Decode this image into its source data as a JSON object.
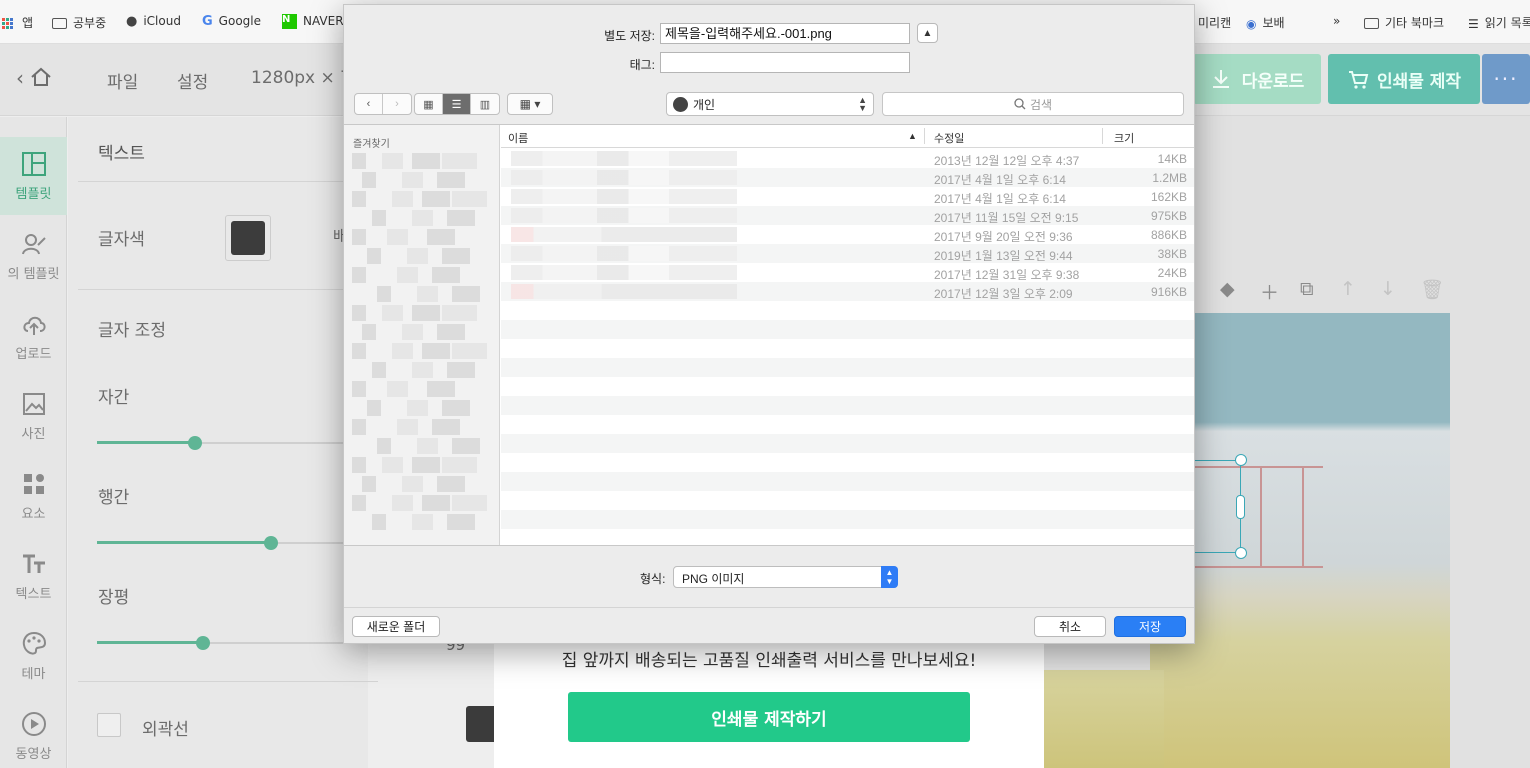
{
  "bookmarks": {
    "items": [
      "앱",
      "공부중",
      "iCloud",
      "Google",
      "NAVER",
      "미리캔",
      "보배",
      "기타 북마크",
      "읽기 목록"
    ],
    "overflow": "»"
  },
  "app_header": {
    "menu_file": "파일",
    "menu_settings": "설정",
    "canvas_size": "1280px × 7",
    "download_label": "다운로드",
    "print_label": "인쇄물 제작",
    "more_label": "···"
  },
  "sidebar": {
    "items": [
      {
        "label": "템플릿",
        "icon": "layout-icon",
        "active": true
      },
      {
        "label": "의 템플릿",
        "icon": "user-edit-icon",
        "active": false
      },
      {
        "label": "업로드",
        "icon": "cloud-upload-icon",
        "active": false
      },
      {
        "label": "사진",
        "icon": "image-icon",
        "active": false
      },
      {
        "label": "요소",
        "icon": "shapes-icon",
        "active": false
      },
      {
        "label": "텍스트",
        "icon": "text-icon",
        "active": false
      },
      {
        "label": "테마",
        "icon": "palette-icon",
        "active": false
      },
      {
        "label": "동영상",
        "icon": "play-icon",
        "active": false
      }
    ]
  },
  "text_panel": {
    "title": "텍스트",
    "font_color_label": "글자색",
    "font_color": "#3c3c3c",
    "adjust_label": "글자 조정",
    "letter_spacing_label": "자간",
    "line_height_label": "행간",
    "width_label": "장평",
    "width_value": "99",
    "outline_label": "외곽선",
    "cut_label": "배"
  },
  "sliders": {
    "letter_spacing": 0.35,
    "line_height": 0.62,
    "width": 0.38
  },
  "promo": {
    "text": "집 앞까지 배송되는 고품질 인쇄출력 서비스를 만나보세요!",
    "button": "인쇄물 제작하기"
  },
  "save_dialog": {
    "save_as_label": "별도 저장:",
    "filename": "제목을-입력해주세요.-001.png",
    "tags_label": "태그:",
    "tags_value": "",
    "location": "개인",
    "search_placeholder": "검색",
    "favorites_title": "즐겨찾기",
    "columns": {
      "name": "이름",
      "modified": "수정일",
      "size": "크기"
    },
    "files": [
      {
        "modified": "2013년 12월 12일 오후 4:37",
        "size": "14KB"
      },
      {
        "modified": "2017년 4월 1일 오후 6:14",
        "size": "1.2MB"
      },
      {
        "modified": "2017년 4월 1일 오후 6:14",
        "size": "162KB"
      },
      {
        "modified": "2017년 11월 15일 오전 9:15",
        "size": "975KB"
      },
      {
        "modified": "2017년 9월 20일 오전 9:36",
        "size": "886KB"
      },
      {
        "modified": "2019년 1월 13일 오전 9:44",
        "size": "38KB"
      },
      {
        "modified": "2017년 12월 31일 오후 9:38",
        "size": "24KB"
      },
      {
        "modified": "2017년 12월 3일 오후 2:09",
        "size": "916KB"
      }
    ],
    "format_label": "형식:",
    "format_value": "PNG 이미지",
    "new_folder": "새로운 폴더",
    "cancel": "취소",
    "save": "저장"
  },
  "colors": {
    "accent_green": "#22c98a",
    "save_blue": "#2a7ff5"
  }
}
